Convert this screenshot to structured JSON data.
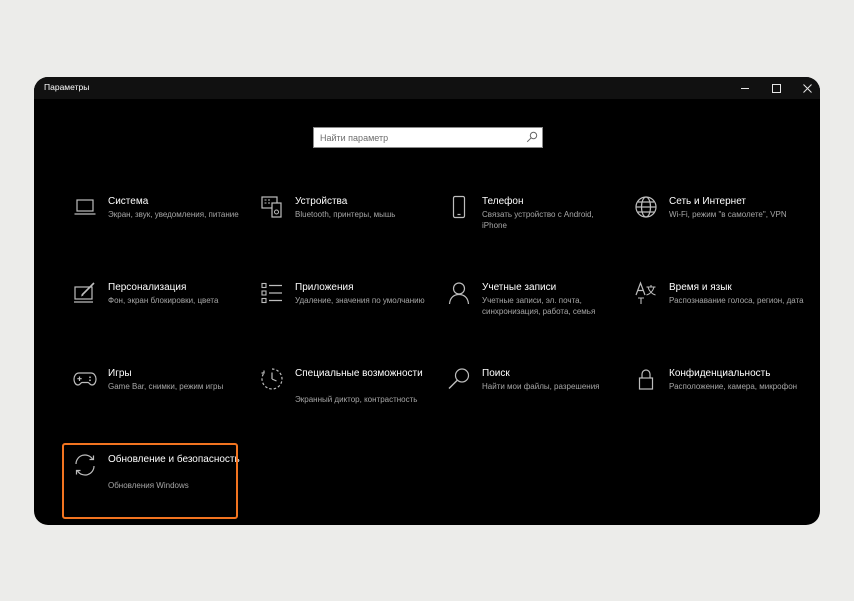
{
  "window": {
    "title": "Параметры",
    "controls": [
      "minimize",
      "maximize",
      "close"
    ]
  },
  "search": {
    "placeholder": "Найти параметр",
    "value": ""
  },
  "tiles": [
    {
      "title": "Система",
      "description": "Экран, звук, уведомления, питание",
      "icon": "laptop-icon"
    },
    {
      "title": "Устройства",
      "description": "Bluetooth, принтеры, мышь",
      "icon": "devices-icon"
    },
    {
      "title": "Телефон",
      "description": "Связать устройство с Android, iPhone",
      "icon": "phone-icon"
    },
    {
      "title": "Сеть и Интернет",
      "description": "Wi-Fi, режим \"в самолете\", VPN",
      "icon": "globe-icon"
    },
    {
      "title": "Персонализация",
      "description": "Фон, экран блокировки, цвета",
      "icon": "personalization-icon"
    },
    {
      "title": "Приложения",
      "description": "Удаление, значения по умолчанию",
      "icon": "apps-list-icon"
    },
    {
      "title": "Учетные записи",
      "description": "Учетные записи, эл. почта, синхронизация, работа, семья",
      "icon": "person-icon"
    },
    {
      "title": "Время и язык",
      "description": "Распознавание голоса, регион, дата",
      "icon": "time-language-icon"
    },
    {
      "title": "Игры",
      "description": "Game Bar, снимки, режим игры",
      "icon": "gamepad-icon"
    },
    {
      "title": "Специальные возможности",
      "description": "Экранный диктор, контрастность",
      "icon": "accessibility-timer-icon"
    },
    {
      "title": "Поиск",
      "description": "Найти мои файлы, разрешения",
      "icon": "magnifier-icon"
    },
    {
      "title": "Конфиденциальность",
      "description": "Расположение, камера, микрофон",
      "icon": "lock-icon"
    },
    {
      "title": "Обновление и безопасность",
      "description": "Обновления Windows",
      "icon": "sync-icon",
      "highlighted": true
    }
  ],
  "colors": {
    "window_bg": "#000000",
    "titlebar_bg": "#111111",
    "highlight": "#f27420",
    "text_primary": "#ffffff",
    "text_secondary": "#a6a6a6",
    "icon": "#bdbdbd"
  }
}
